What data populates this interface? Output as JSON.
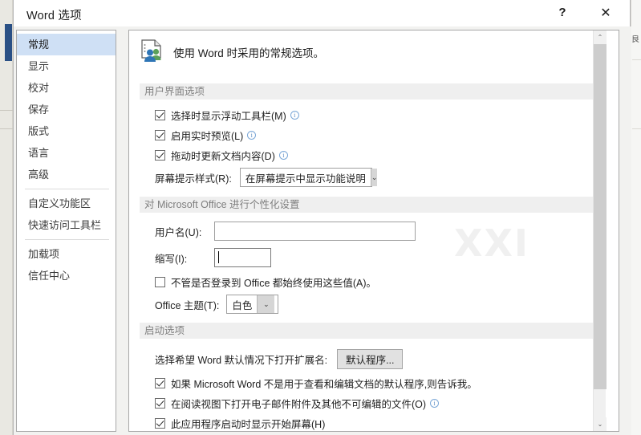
{
  "window": {
    "title": "Word 选项",
    "help_icon": "?",
    "close_icon": "✕"
  },
  "sidebar": {
    "items": [
      {
        "label": "常规",
        "selected": true
      },
      {
        "label": "显示",
        "selected": false
      },
      {
        "label": "校对",
        "selected": false
      },
      {
        "label": "保存",
        "selected": false
      },
      {
        "label": "版式",
        "selected": false
      },
      {
        "label": "语言",
        "selected": false
      },
      {
        "label": "高级",
        "selected": false
      },
      {
        "label": "自定义功能区",
        "selected": false
      },
      {
        "label": "快速访问工具栏",
        "selected": false
      },
      {
        "label": "加载项",
        "selected": false
      },
      {
        "label": "信任中心",
        "selected": false
      }
    ],
    "separator_after": [
      6,
      8
    ]
  },
  "content": {
    "header": "使用 Word 时采用的常规选项。",
    "header_icon": "document-people-icon",
    "watermark": "XXI",
    "sections": [
      {
        "title": "用户界面选项",
        "checkboxes": [
          {
            "label": "选择时显示浮动工具栏(M)",
            "accel": "M",
            "checked": true,
            "info": true
          },
          {
            "label": "启用实时预览(L)",
            "accel": "L",
            "checked": true,
            "info": true
          },
          {
            "label": "拖动时更新文档内容(D)",
            "accel": "D",
            "checked": true,
            "info": true
          }
        ],
        "dropdown": {
          "label": "屏幕提示样式(R):",
          "accel": "R",
          "value": "在屏幕提示中显示功能说明",
          "arrow": "⌄"
        }
      },
      {
        "title": "对 Microsoft Office 进行个性化设置",
        "fields": [
          {
            "label": "用户名(U):",
            "accel": "U",
            "value": "",
            "placeholder": ""
          },
          {
            "label": "缩写(I):",
            "accel": "I",
            "value": "",
            "placeholder": "",
            "focused": true
          }
        ],
        "checkbox": {
          "label": "不管是否登录到 Office 都始终使用这些值(A)。",
          "accel": "A",
          "checked": false
        },
        "theme": {
          "label": "Office 主题(T):",
          "accel": "T",
          "value": "白色",
          "arrow": "⌄"
        }
      },
      {
        "title": "启动选项",
        "default_programs": {
          "label": "选择希望 Word 默认情况下打开扩展名:",
          "button": "默认程序..."
        },
        "checkboxes": [
          {
            "label": "如果 Microsoft Word 不是用于查看和编辑文档的默认程序,则告诉我。",
            "checked": true,
            "info": false
          },
          {
            "label": "在阅读视图下打开电子邮件附件及其他不可编辑的文件(O)",
            "accel": "O",
            "checked": true,
            "info": true
          },
          {
            "label": "此应用程序启动时显示开始屏幕(H)",
            "accel": "H",
            "checked": true,
            "info": false
          }
        ]
      }
    ]
  },
  "scrollbar": {
    "up_arrow": "⌃",
    "down_arrow": "⌄"
  },
  "colors": {
    "accent_selected": "#cfe0f5",
    "section_bar": "#efefef",
    "section_text": "#7f7f7f",
    "bg_blue_tab": "#2a5085",
    "button_face": "#e1e1e1"
  }
}
